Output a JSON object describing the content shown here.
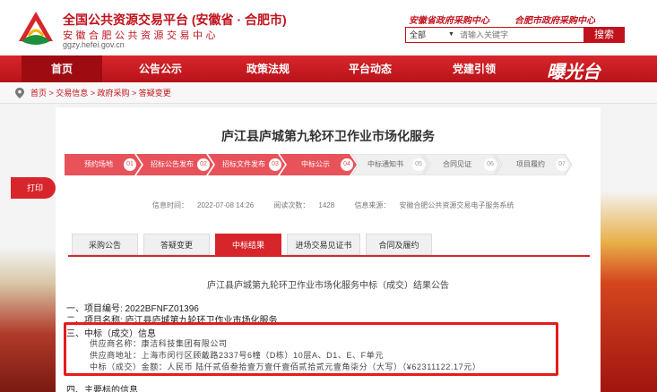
{
  "header": {
    "title": "全国公共资源交易平台 (安徽省 · 合肥市)",
    "subtitle": "安徽合肥公共资源交易中心",
    "url": "ggzy.hefei.gov.cn",
    "link_provincial": "安徽省政府采购中心",
    "link_city": "合肥市政府采购中心",
    "search_scope": "全部",
    "search_placeholder": "请输入关键字",
    "search_button": "搜索"
  },
  "nav": {
    "items": [
      "首页",
      "公告公示",
      "政策法规",
      "平台动态",
      "党建引领"
    ],
    "active_index": 0,
    "brand_script": "曝光台"
  },
  "breadcrumb": "首页 > 交易信息 > 政府采购 > 答疑变更",
  "print_label": "打印",
  "article": {
    "title": "庐江县庐城第九轮环卫作业市场化服务",
    "steps": [
      {
        "label": "预约场地",
        "num": "01"
      },
      {
        "label": "招标公告发布",
        "num": "02"
      },
      {
        "label": "招标文件发布",
        "num": "03"
      },
      {
        "label": "中标公示",
        "num": "04"
      },
      {
        "label": "中标通知书",
        "num": "05"
      },
      {
        "label": "合同见证",
        "num": "06"
      },
      {
        "label": "项目履约",
        "num": "07"
      }
    ],
    "meta": {
      "time_label": "信息时间：",
      "time_value": "2022-07-08 14:26",
      "views_label": "阅读次数：",
      "views_value": "1428",
      "source_label": "信息来源：",
      "source_value": "安徽合肥公共资源交易电子服务系统"
    },
    "tabs": [
      "采购公告",
      "答疑变更",
      "中标结果",
      "进场交易见证书",
      "合同及履约"
    ],
    "active_tab": 2,
    "notice_title": "庐江县庐城第九轮环卫作业市场化服务中标（成交）结果公告",
    "lines": {
      "project_no": "一、项目编号: 2022BFNFZ01396",
      "project_name": "二、项目名称: 庐江县庐城第九轮环卫作业市场化服务",
      "award_info": "三、中标（成交）信息",
      "supplier_name": "供应商名称：康洁科技集团有限公司",
      "supplier_address": "供应商地址：上海市闵行区顾戴路2337号6幢（D栋）10层A、D1、E、F单元",
      "award_amount": "中标（成交）金额：人民币 陆仟贰佰叁拾壹万壹仟壹佰贰拾贰元壹角柒分（大写）（¥62311122.17元）",
      "main_subject": "四、主要标的信息"
    }
  },
  "colors": {
    "brand_red": "#d7262b",
    "dark_red": "#9e0b11",
    "step_done": "#e8525a",
    "step_pending": "#f0f0f0",
    "highlight": "#e41c1c"
  }
}
